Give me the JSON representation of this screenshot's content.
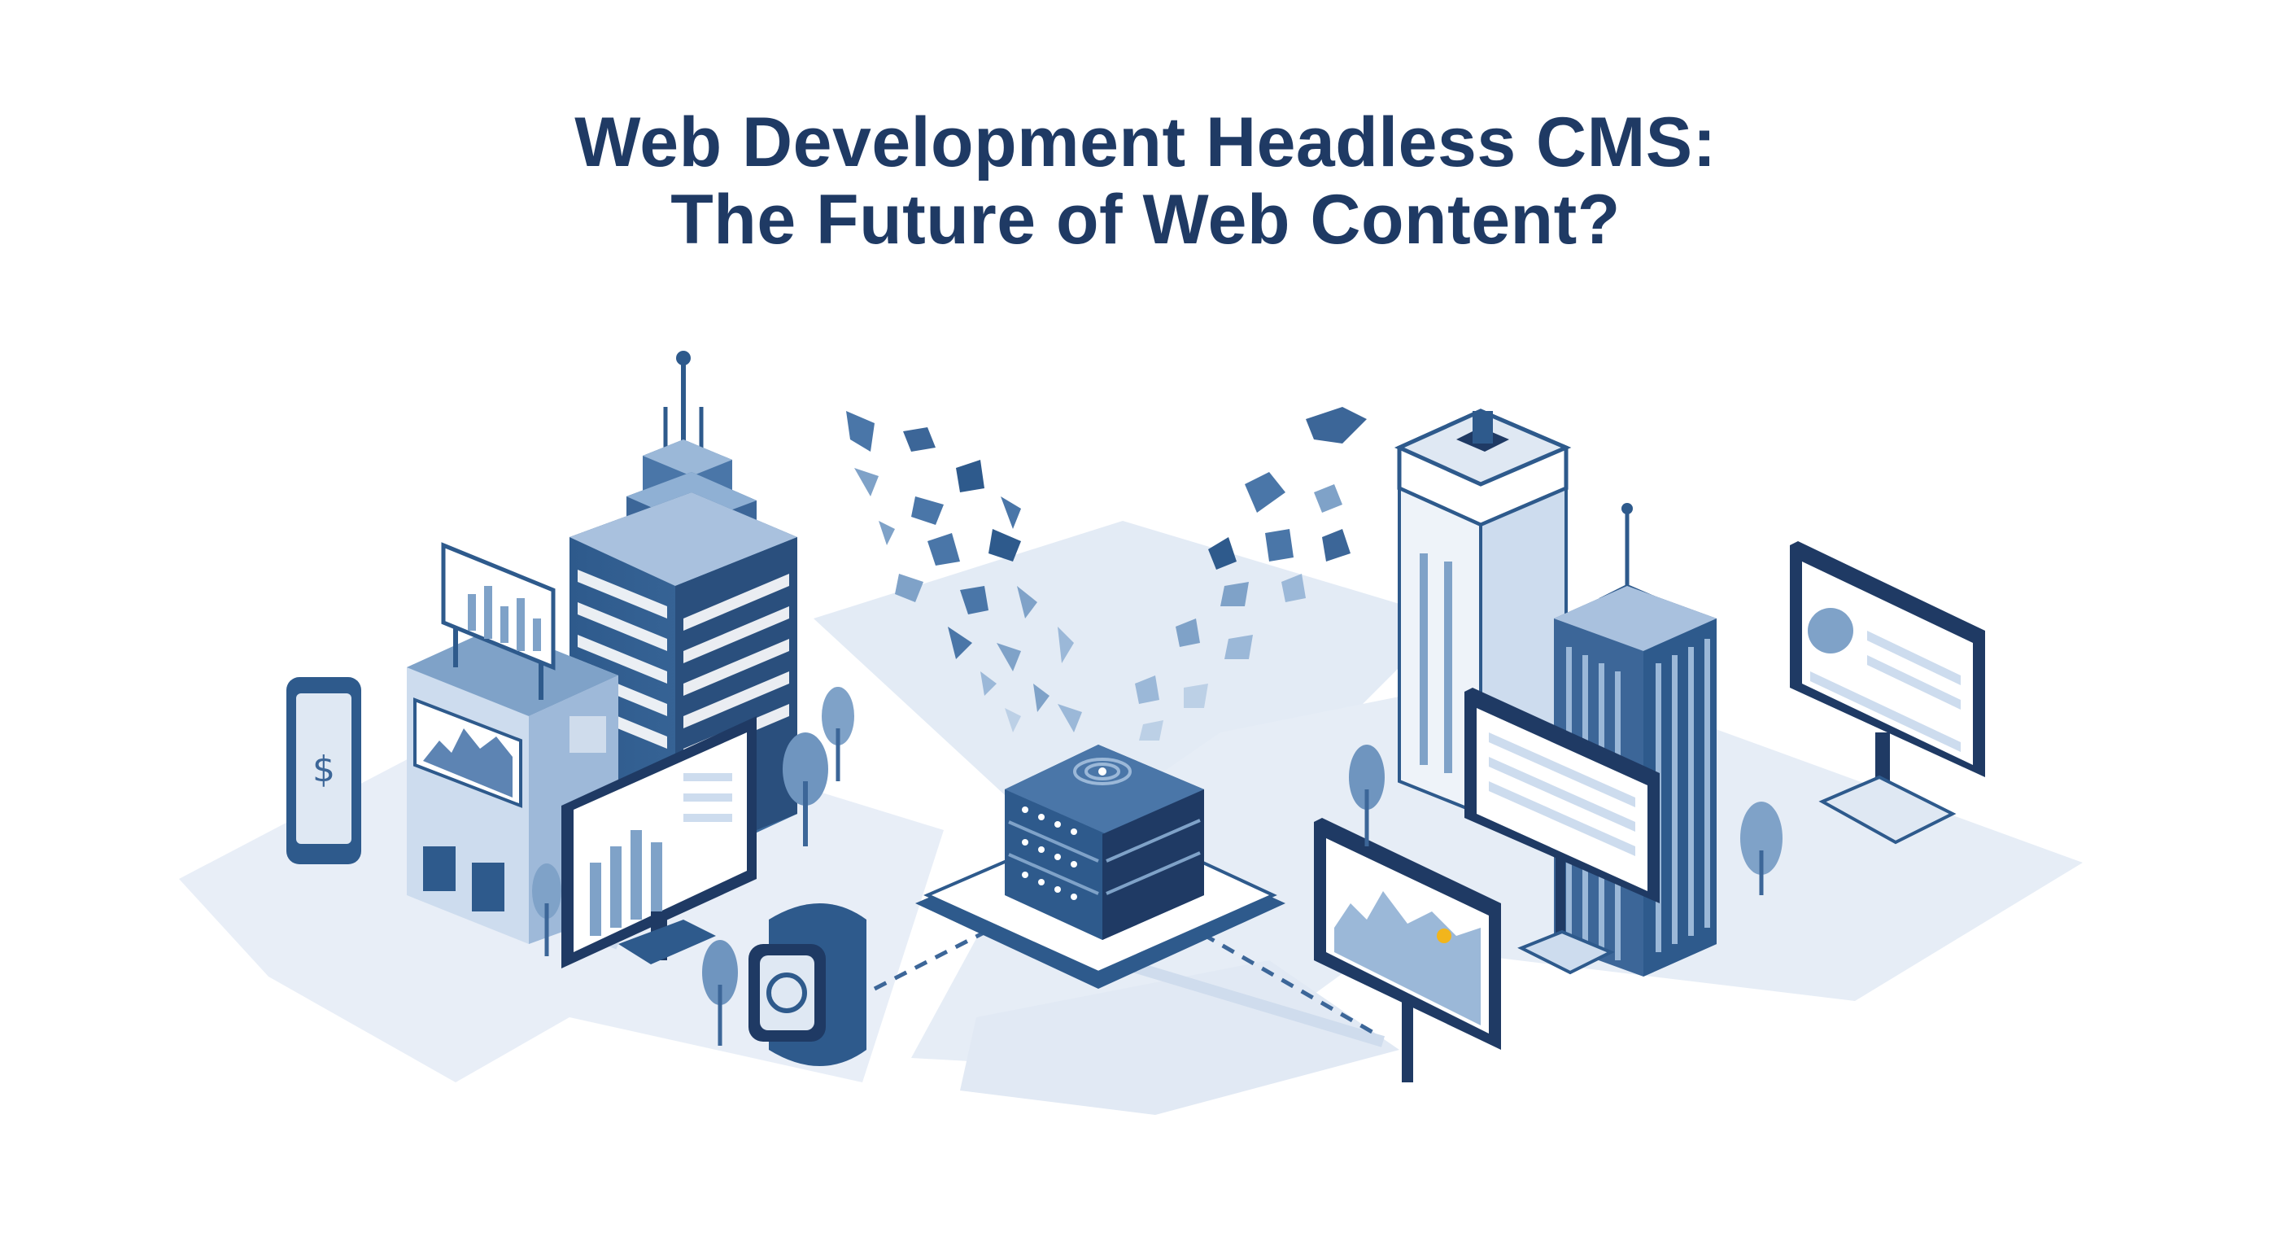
{
  "title": {
    "line1": "Web Development Headless CMS:",
    "line2": "The Future of Web Content?"
  },
  "colors": {
    "title": "#1f3a64",
    "dark_navy": "#1f3a64",
    "mid_blue": "#3c6698",
    "light_blue": "#7fa2c8",
    "pale_blue": "#dfe8f3",
    "ground": "#e6edf6",
    "accent_yellow": "#f2b51c"
  },
  "icons": [
    "smartphone-icon",
    "smartwatch-icon",
    "server-stack-icon",
    "monitor-icon",
    "billboard-icon",
    "office-tower-icon",
    "tree-icon",
    "content-block-icon"
  ]
}
